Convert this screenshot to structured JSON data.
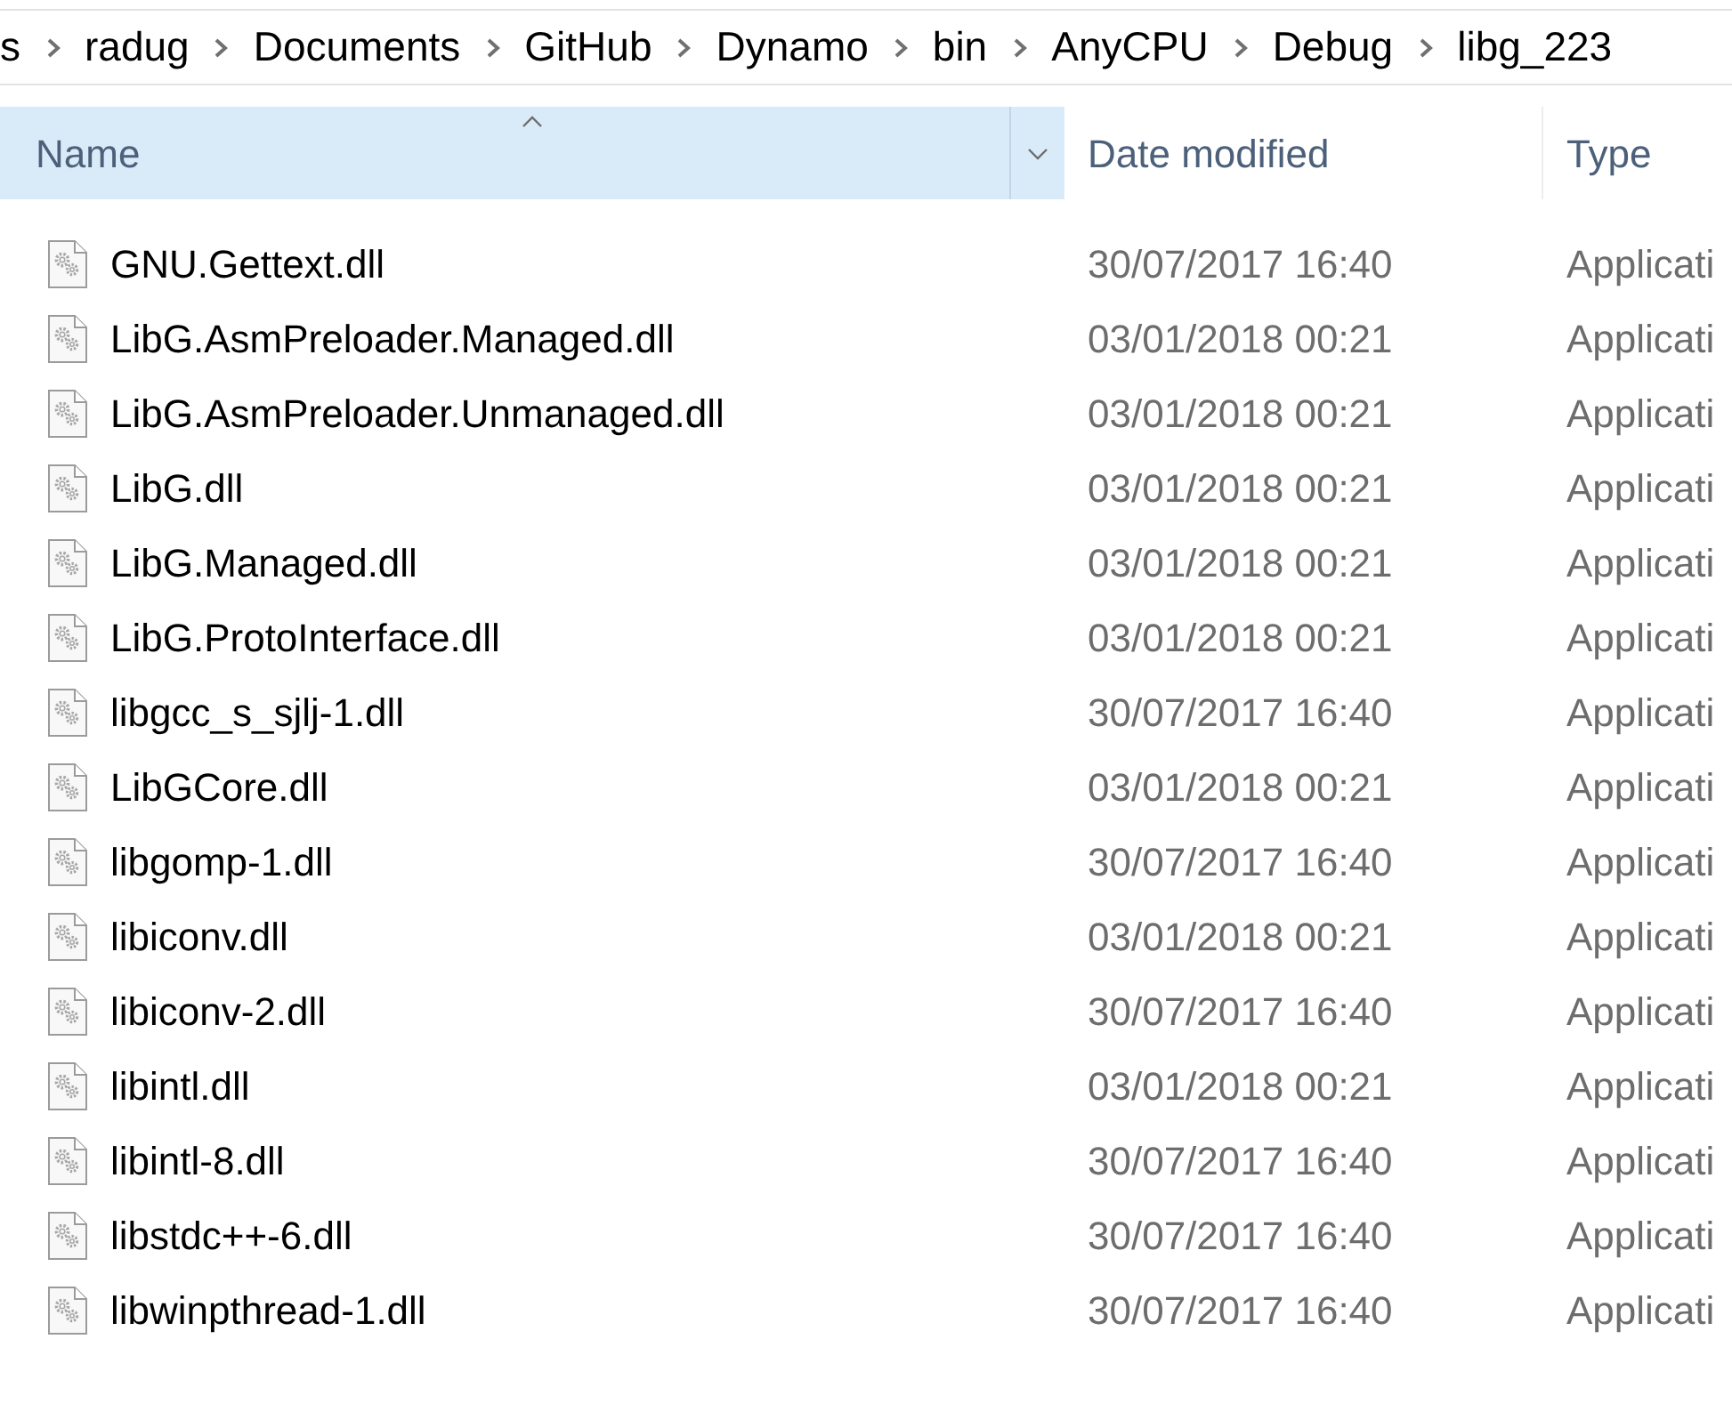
{
  "breadcrumb": [
    "s",
    "radug",
    "Documents",
    "GitHub",
    "Dynamo",
    "bin",
    "AnyCPU",
    "Debug",
    "libg_223"
  ],
  "columns": [
    {
      "label": "Name",
      "selected": true,
      "sorted": true
    },
    {
      "label": "Date modified",
      "selected": false,
      "sorted": false
    },
    {
      "label": "Type",
      "selected": false,
      "sorted": false
    }
  ],
  "files": [
    {
      "name": "GNU.Gettext.dll",
      "date_modified": "30/07/2017 16:40",
      "type": "Applicati"
    },
    {
      "name": "LibG.AsmPreloader.Managed.dll",
      "date_modified": "03/01/2018 00:21",
      "type": "Applicati"
    },
    {
      "name": "LibG.AsmPreloader.Unmanaged.dll",
      "date_modified": "03/01/2018 00:21",
      "type": "Applicati"
    },
    {
      "name": "LibG.dll",
      "date_modified": "03/01/2018 00:21",
      "type": "Applicati"
    },
    {
      "name": "LibG.Managed.dll",
      "date_modified": "03/01/2018 00:21",
      "type": "Applicati"
    },
    {
      "name": "LibG.ProtoInterface.dll",
      "date_modified": "03/01/2018 00:21",
      "type": "Applicati"
    },
    {
      "name": "libgcc_s_sjlj-1.dll",
      "date_modified": "30/07/2017 16:40",
      "type": "Applicati"
    },
    {
      "name": "LibGCore.dll",
      "date_modified": "03/01/2018 00:21",
      "type": "Applicati"
    },
    {
      "name": "libgomp-1.dll",
      "date_modified": "30/07/2017 16:40",
      "type": "Applicati"
    },
    {
      "name": "libiconv.dll",
      "date_modified": "03/01/2018 00:21",
      "type": "Applicati"
    },
    {
      "name": "libiconv-2.dll",
      "date_modified": "30/07/2017 16:40",
      "type": "Applicati"
    },
    {
      "name": "libintl.dll",
      "date_modified": "03/01/2018 00:21",
      "type": "Applicati"
    },
    {
      "name": "libintl-8.dll",
      "date_modified": "30/07/2017 16:40",
      "type": "Applicati"
    },
    {
      "name": "libstdc++-6.dll",
      "date_modified": "30/07/2017 16:40",
      "type": "Applicati"
    },
    {
      "name": "libwinpthread-1.dll",
      "date_modified": "30/07/2017 16:40",
      "type": "Applicati"
    }
  ]
}
